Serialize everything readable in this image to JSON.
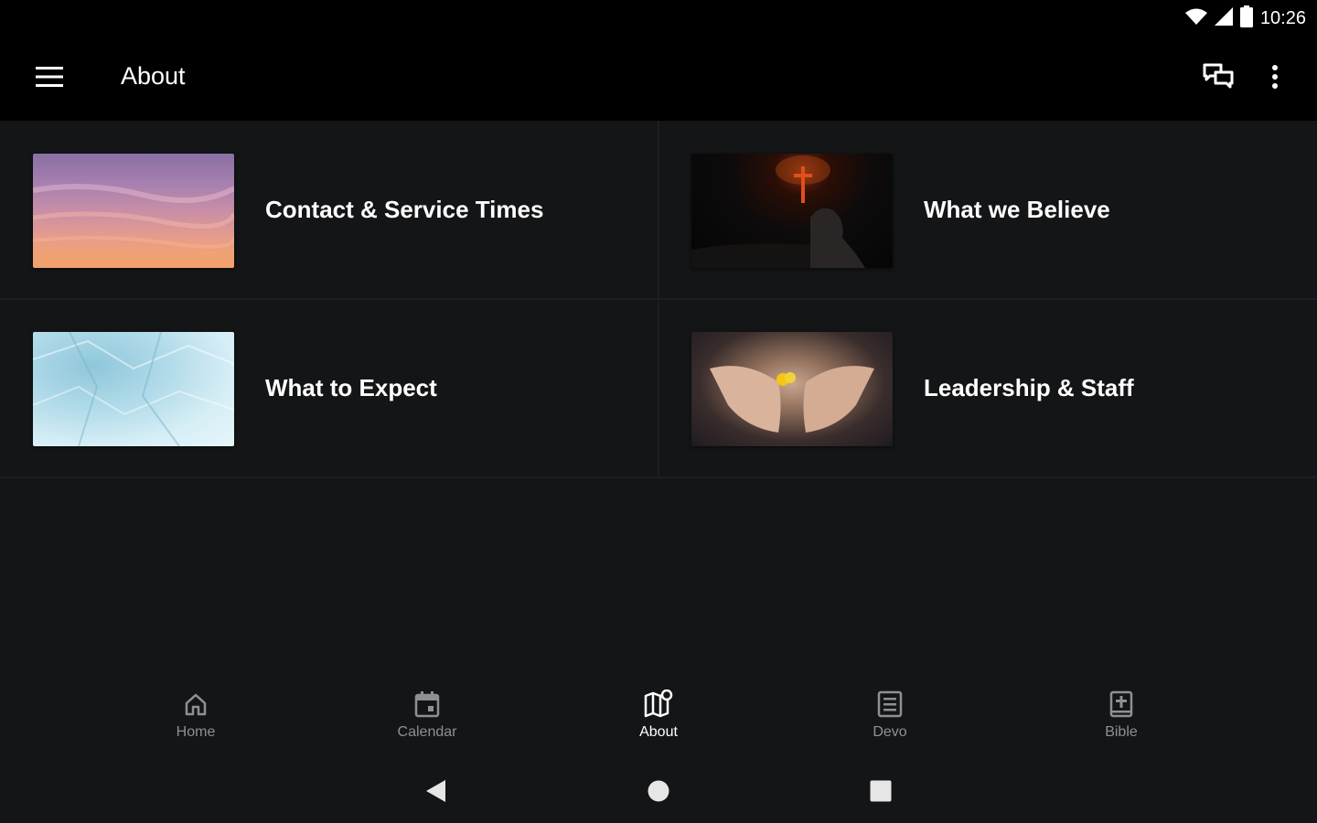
{
  "status_bar": {
    "time": "10:26",
    "icons": [
      "wifi-icon",
      "cell-signal-icon",
      "battery-icon"
    ]
  },
  "app_bar": {
    "title": "About",
    "menu_icon": "hamburger-menu-icon",
    "actions": [
      "chat-icon",
      "more-vert-icon"
    ]
  },
  "tiles": [
    {
      "label": "Contact & Service Times",
      "thumb": "sunset-sky-image"
    },
    {
      "label": "What we Believe",
      "thumb": "cross-worship-image"
    },
    {
      "label": "What to Expect",
      "thumb": "ice-texture-image"
    },
    {
      "label": "Leadership & Staff",
      "thumb": "open-hands-flower-image"
    }
  ],
  "bottom_nav": {
    "items": [
      {
        "label": "Home",
        "icon": "home-icon"
      },
      {
        "label": "Calendar",
        "icon": "calendar-icon"
      },
      {
        "label": "About",
        "icon": "about-map-icon"
      },
      {
        "label": "Devo",
        "icon": "devo-book-icon"
      },
      {
        "label": "Bible",
        "icon": "bible-icon"
      }
    ],
    "active": "About"
  },
  "system_nav": [
    "back-icon",
    "home-circle-icon",
    "recents-square-icon"
  ],
  "colors": {
    "background": "#141517",
    "app_bar": "#000000",
    "text": "#ffffff",
    "inactive_nav": "#8f9094"
  }
}
